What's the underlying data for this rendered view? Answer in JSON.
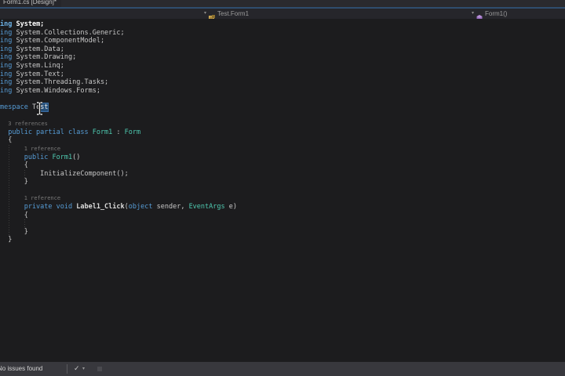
{
  "window": {
    "tab_title": "Form1.cs [Design]*"
  },
  "navigation_bar": {
    "left_dropdown": {
      "label": "Test.Form1",
      "arrow": "▾",
      "icon": "class-icon"
    },
    "right_dropdown": {
      "label": "Form1()",
      "arrow": "▾",
      "icon": "method-icon"
    }
  },
  "editor": {
    "selection": {
      "word": "Test",
      "selected_part": "st"
    },
    "lines": [
      {
        "indent": 0,
        "bright": true,
        "seg": [
          {
            "t": "ing",
            "c": "kw"
          },
          {
            "t": " System;",
            "c": "pl"
          }
        ]
      },
      {
        "indent": 0,
        "seg": [
          {
            "t": "ing",
            "c": "kw"
          },
          {
            "t": " System.Collections.Generic;",
            "c": "pl"
          }
        ]
      },
      {
        "indent": 0,
        "seg": [
          {
            "t": "ing",
            "c": "kw"
          },
          {
            "t": " System.ComponentModel;",
            "c": "pl"
          }
        ]
      },
      {
        "indent": 0,
        "seg": [
          {
            "t": "ing",
            "c": "kw"
          },
          {
            "t": " System.Data;",
            "c": "pl"
          }
        ]
      },
      {
        "indent": 0,
        "seg": [
          {
            "t": "ing",
            "c": "kw"
          },
          {
            "t": " System.Drawing;",
            "c": "pl"
          }
        ]
      },
      {
        "indent": 0,
        "seg": [
          {
            "t": "ing",
            "c": "kw"
          },
          {
            "t": " System.Linq;",
            "c": "pl"
          }
        ]
      },
      {
        "indent": 0,
        "seg": [
          {
            "t": "ing",
            "c": "kw"
          },
          {
            "t": " System.Text;",
            "c": "pl"
          }
        ]
      },
      {
        "indent": 0,
        "seg": [
          {
            "t": "ing",
            "c": "kw"
          },
          {
            "t": " System.Threading.Tasks;",
            "c": "pl"
          }
        ]
      },
      {
        "indent": 0,
        "seg": [
          {
            "t": "ing",
            "c": "kw"
          },
          {
            "t": " System.Windows.Forms;",
            "c": "pl"
          }
        ]
      },
      {
        "indent": 0,
        "seg": []
      },
      {
        "indent": 0,
        "seg": [
          {
            "t": "mespace",
            "c": "kw"
          },
          {
            "t": " Te",
            "c": "pl"
          },
          {
            "t": "st",
            "c": "sel"
          }
        ]
      },
      {
        "indent": 0,
        "seg": []
      },
      {
        "indent": 2,
        "seg": [
          {
            "t": "3 references",
            "c": "lens"
          }
        ]
      },
      {
        "indent": 2,
        "seg": [
          {
            "t": "public partial class ",
            "c": "kw"
          },
          {
            "t": "Form1",
            "c": "ty"
          },
          {
            "t": " : ",
            "c": "pl"
          },
          {
            "t": "Form",
            "c": "ty"
          }
        ]
      },
      {
        "indent": 2,
        "seg": [
          {
            "t": "{",
            "c": "pl"
          }
        ]
      },
      {
        "indent": 6,
        "seg": [
          {
            "t": "1 reference",
            "c": "lens"
          }
        ]
      },
      {
        "indent": 6,
        "seg": [
          {
            "t": "public ",
            "c": "kw"
          },
          {
            "t": "Form1",
            "c": "ty"
          },
          {
            "t": "()",
            "c": "pl"
          }
        ]
      },
      {
        "indent": 6,
        "seg": [
          {
            "t": "{",
            "c": "pl"
          }
        ]
      },
      {
        "indent": 10,
        "seg": [
          {
            "t": "InitializeComponent();",
            "c": "pl"
          }
        ]
      },
      {
        "indent": 6,
        "seg": [
          {
            "t": "}",
            "c": "pl"
          }
        ]
      },
      {
        "indent": 0,
        "seg": []
      },
      {
        "indent": 6,
        "seg": [
          {
            "t": "1 reference",
            "c": "lens"
          }
        ]
      },
      {
        "indent": 6,
        "seg": [
          {
            "t": "private void ",
            "c": "kw"
          },
          {
            "t": "Label1_Click",
            "c": "mth"
          },
          {
            "t": "(",
            "c": "pl"
          },
          {
            "t": "object",
            "c": "kw"
          },
          {
            "t": " sender, ",
            "c": "pl"
          },
          {
            "t": "EventArgs",
            "c": "ty"
          },
          {
            "t": " e)",
            "c": "pl"
          }
        ]
      },
      {
        "indent": 6,
        "seg": [
          {
            "t": "{",
            "c": "pl"
          }
        ]
      },
      {
        "indent": 0,
        "seg": []
      },
      {
        "indent": 6,
        "seg": [
          {
            "t": "}",
            "c": "pl"
          }
        ]
      },
      {
        "indent": 2,
        "seg": [
          {
            "t": "}",
            "c": "pl"
          }
        ]
      }
    ]
  },
  "status_bar": {
    "message": "No issues found",
    "check_icon": "✓",
    "dropdown_arrow": "▾"
  },
  "colors": {
    "accent_line": "#2f4d6e",
    "selection": "#264f78",
    "keyword": "#569cd6",
    "type": "#4ec9b0",
    "editor_bg": "#1c1c1e",
    "status_bg": "#38383d"
  }
}
